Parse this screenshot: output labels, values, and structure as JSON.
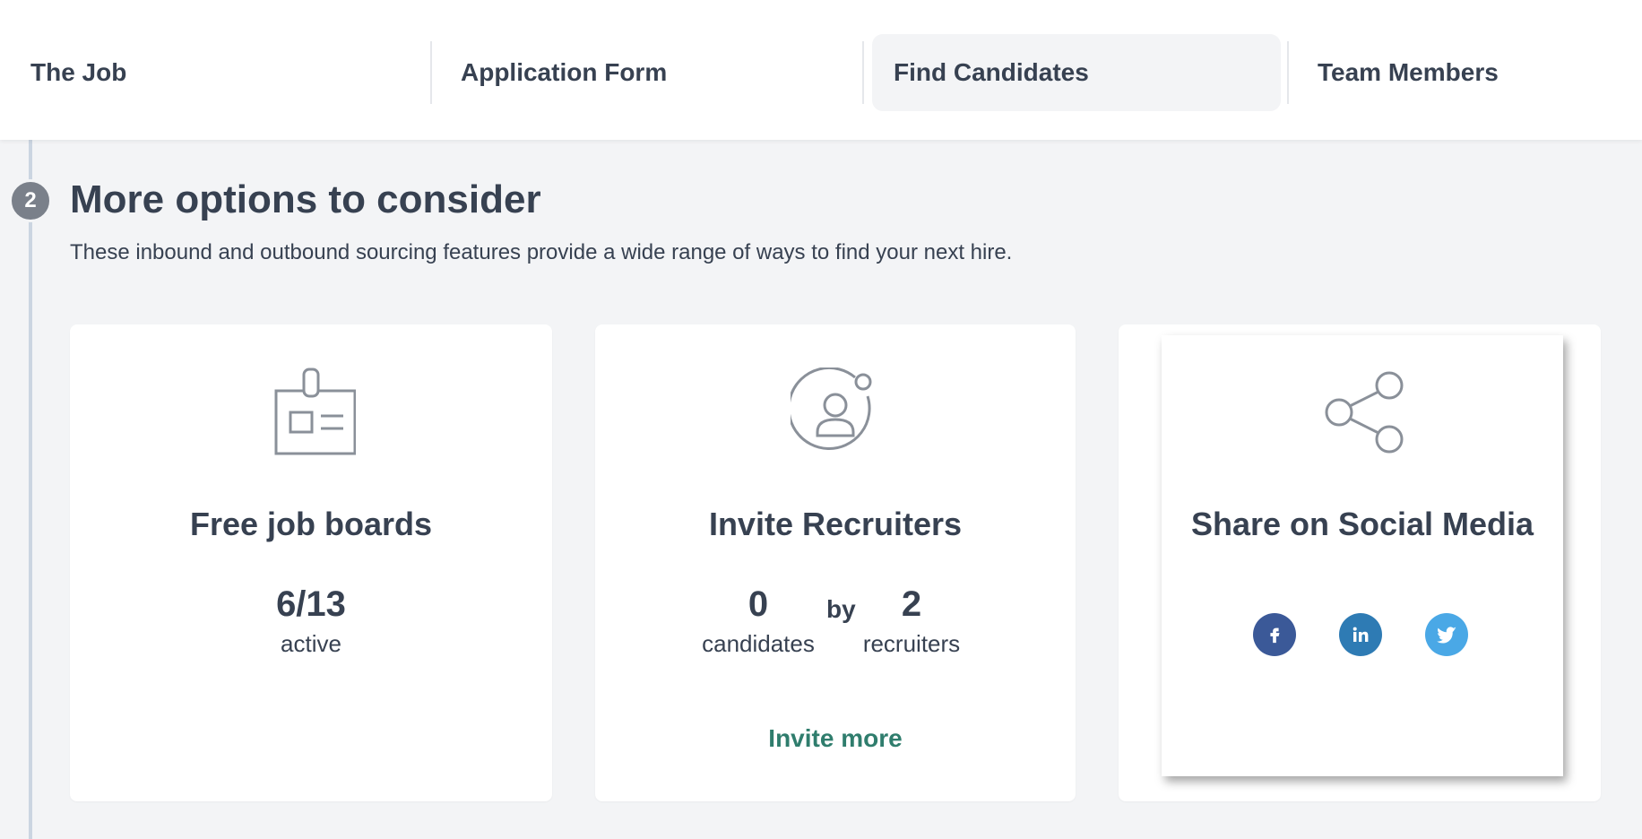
{
  "tabs": [
    {
      "label": "The Job",
      "active": false
    },
    {
      "label": "Application Form",
      "active": false
    },
    {
      "label": "Find Candidates",
      "active": true
    },
    {
      "label": "Team Members",
      "active": false
    }
  ],
  "section": {
    "step": "2",
    "title": "More options to consider",
    "description": "These inbound and outbound sourcing features provide a wide range of ways to find your next hire."
  },
  "cards": {
    "job_boards": {
      "icon": "id-badge-icon",
      "title": "Free job boards",
      "count": "6/13",
      "count_label": "active"
    },
    "recruiters": {
      "icon": "user-circle-icon",
      "title": "Invite Recruiters",
      "candidates_count": "0",
      "candidates_label": "candidates",
      "by_label": "by",
      "recruiters_count": "2",
      "recruiters_label": "recruiters",
      "invite_more_label": "Invite more"
    },
    "social": {
      "icon": "share-icon",
      "title": "Share on Social Media",
      "networks": [
        {
          "name": "facebook",
          "glyph": "f",
          "color": "#3b5998"
        },
        {
          "name": "linkedin",
          "glyph": "in",
          "color": "#2e7bb4"
        },
        {
          "name": "twitter",
          "glyph": "t",
          "color": "#4aa8e6"
        }
      ]
    }
  },
  "colors": {
    "accent_link": "#2f7d6d",
    "badge_bg": "#7a808a",
    "icon_stroke": "#8a9099",
    "text": "#374151"
  }
}
